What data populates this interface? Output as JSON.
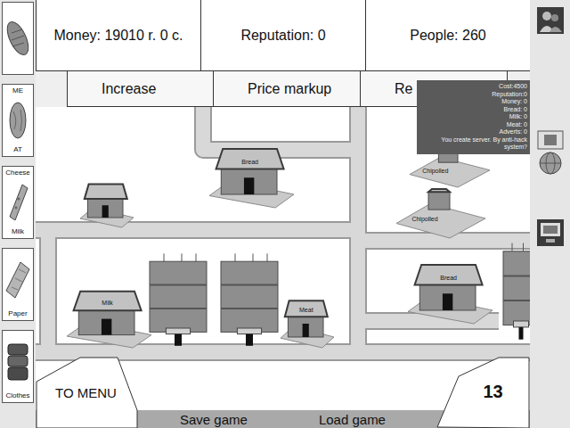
{
  "stats": [
    "Money: 19010 r. 0 c.",
    "Reputation: 0",
    "People: 260"
  ],
  "tabs": [
    {
      "label": "Increase",
      "selected": false
    },
    {
      "label": "Price markup",
      "selected": false
    },
    {
      "label": "Re",
      "selected": false
    }
  ],
  "tooltip": {
    "lines": [
      "Cost:4500",
      "Reputation:0",
      "Money: 0",
      "Bread: 0",
      "Milk: 0",
      "Meat: 0",
      "Adverts: 0",
      "You create server. By anti-hack system?"
    ]
  },
  "sidebar": {
    "items": [
      {
        "kind": "bread"
      },
      {
        "kind": "meat",
        "top": "ME",
        "bottom": "AT"
      },
      {
        "kind": "cheese",
        "top": "Cheese",
        "bottom": "Milk"
      },
      {
        "kind": "paper",
        "bottom": "Paper"
      },
      {
        "kind": "clothes",
        "bottom": "Clothes"
      }
    ]
  },
  "map": {
    "buildings": [
      {
        "kind": "shop"
      },
      {
        "kind": "shop",
        "label": "Bread"
      },
      {
        "kind": "stall",
        "label": "Chipolled"
      },
      {
        "kind": "stall",
        "label": "Chipolled"
      },
      {
        "kind": "shop",
        "label": "Bread"
      },
      {
        "kind": "shop",
        "label": "Milk"
      },
      {
        "kind": "tower"
      },
      {
        "kind": "tower"
      },
      {
        "kind": "shop",
        "label": "Meat"
      },
      {
        "kind": "tower"
      }
    ]
  },
  "bottom": {
    "menu_button": "TO MENU",
    "turn": "13",
    "save": "Save game",
    "load": "Load game"
  }
}
